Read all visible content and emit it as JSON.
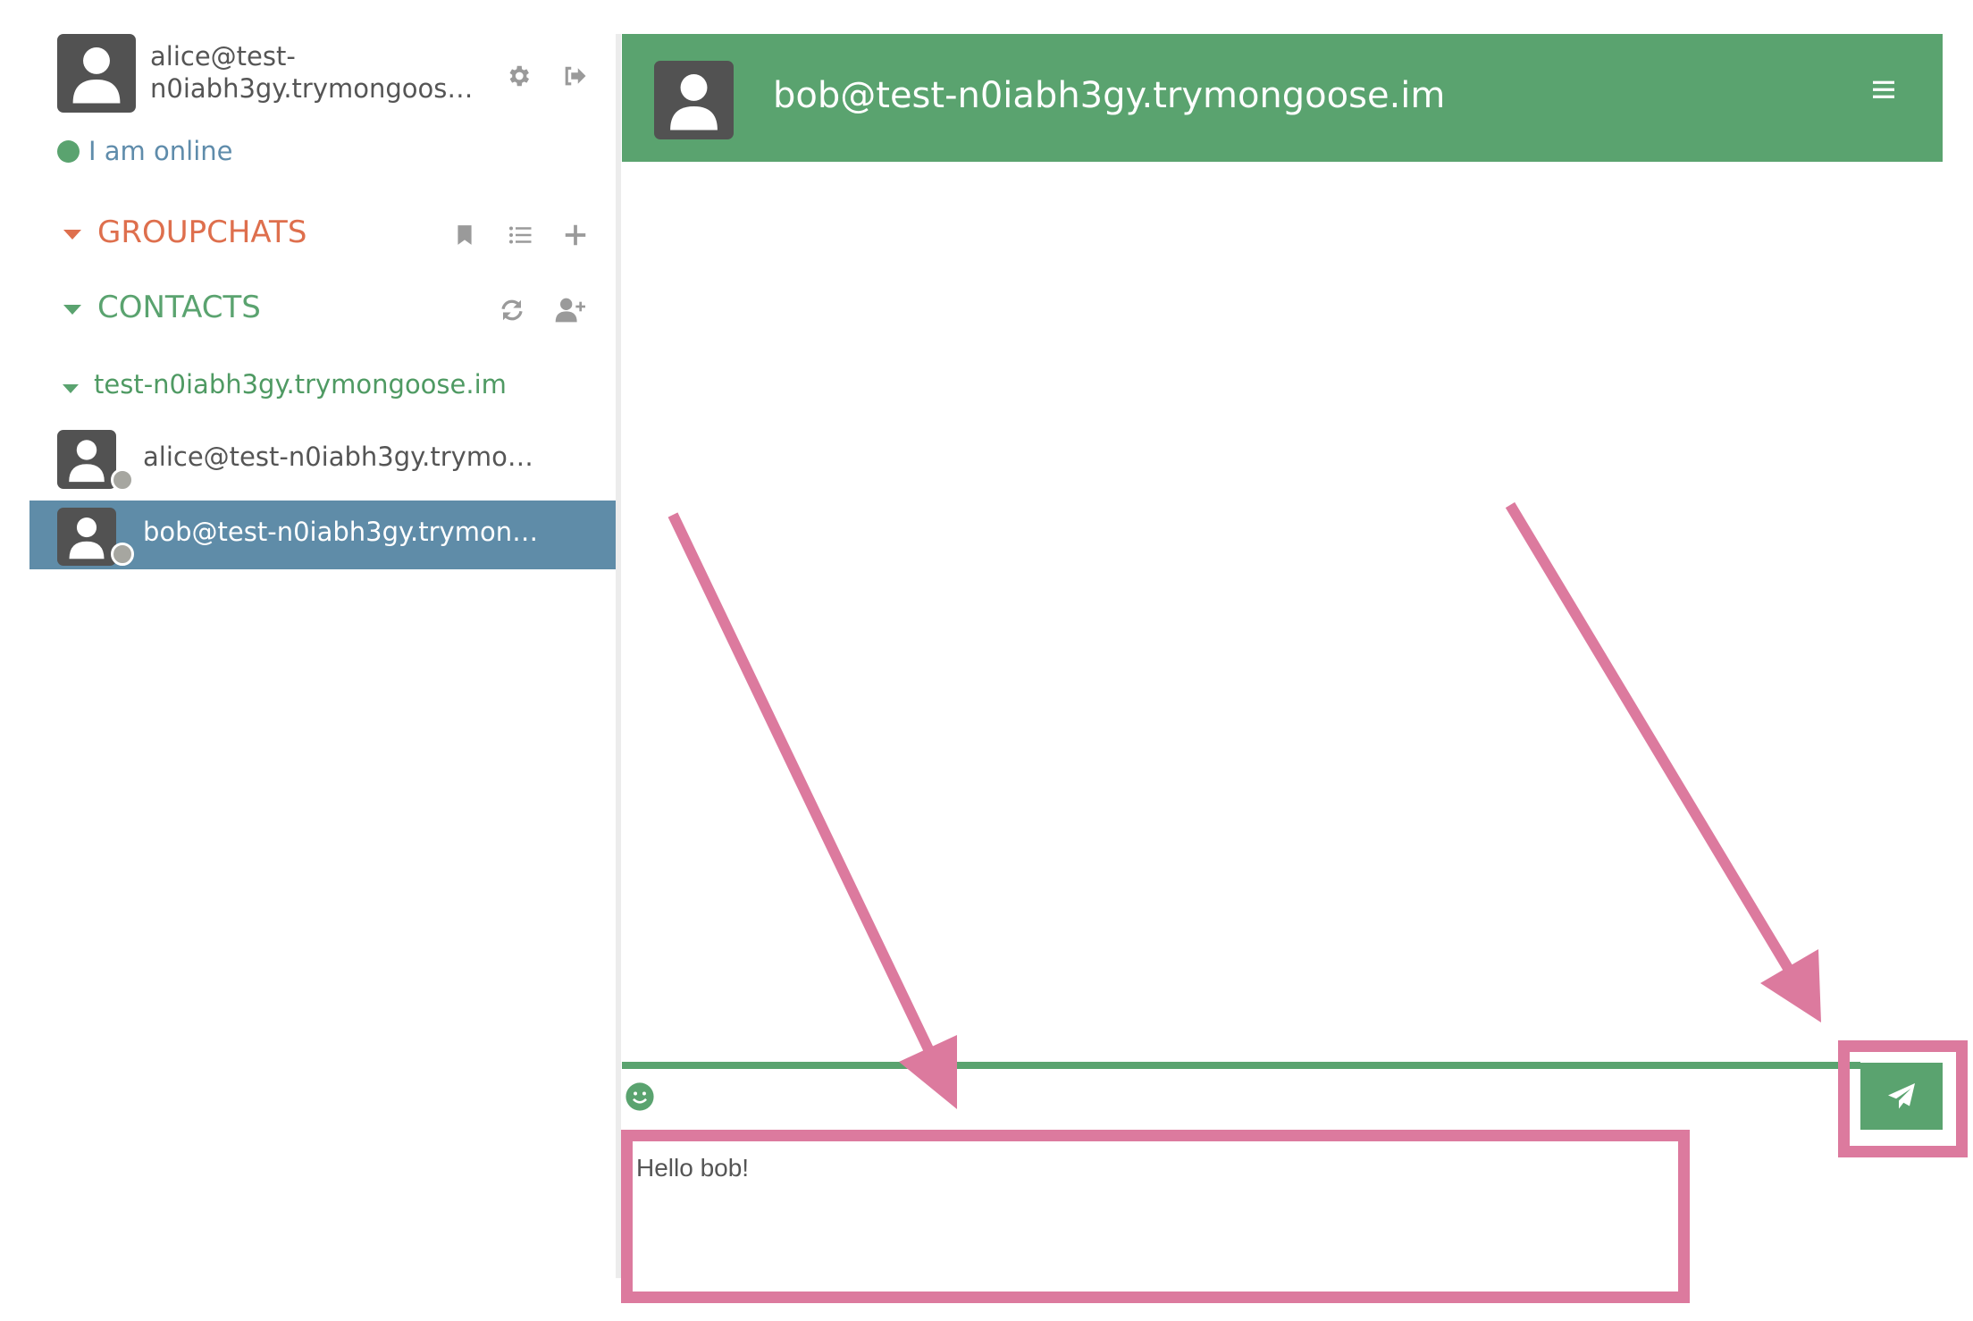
{
  "user": {
    "name_line1": "alice@test-",
    "name_line2": "n0iabh3gy.trymongoos…",
    "status": "I am online",
    "status_color": "#5aa36f"
  },
  "sidebar": {
    "groupchats_label": "GROUPCHATS",
    "contacts_label": "CONTACTS",
    "domain_group": "test-n0iabh3gy.trymongoose.im",
    "contacts": [
      {
        "name": "alice@test-n0iabh3gy.trymo…",
        "selected": false
      },
      {
        "name": "bob@test-n0iabh3gy.trymon…",
        "selected": true
      }
    ]
  },
  "chat": {
    "title": "bob@test-n0iabh3gy.trymongoose.im",
    "message_draft": "Hello bob!"
  },
  "colors": {
    "accent": "#5aa36f",
    "groupchats": "#de6f4d",
    "selected": "#5f8ca8",
    "annotation": "#dc7a9e"
  },
  "icons": [
    "user-avatar-icon",
    "gear-icon",
    "logout-icon",
    "bookmark-icon",
    "list-icon",
    "plus-icon",
    "refresh-icon",
    "add-user-icon",
    "hamburger-icon",
    "smiley-icon",
    "send-icon"
  ]
}
